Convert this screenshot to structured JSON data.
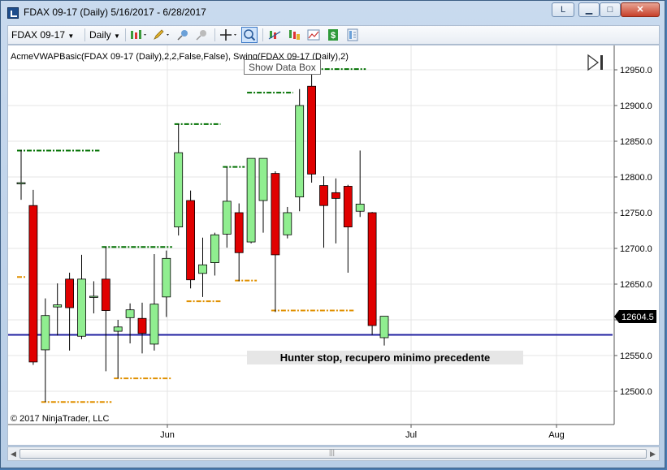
{
  "window": {
    "title": "FDAX 09-17 (Daily)  5/16/2017 - 6/28/2017",
    "layout_button": "L",
    "minimize_glyph": "▁",
    "maximize_glyph": "□",
    "close_glyph": "✕"
  },
  "toolbar": {
    "instrument": "FDAX 09-17",
    "period": "Daily",
    "icons": [
      "bar-type-icon",
      "pencil-draw-icon",
      "pin-icon",
      "unpin-icon",
      "crosshair-icon",
      "zoom-icon",
      "indicators-icon",
      "strategies-icon",
      "chart-style-icon",
      "dollar-icon",
      "properties-icon"
    ]
  },
  "tooltip": {
    "text": "Show Data Box"
  },
  "chart": {
    "indicator_label": "AcmeVWAPBasic(FDAX 09-17 (Daily),2,2,False,False), Swing(FDAX 09-17 (Daily),2)",
    "copyright": "© 2017 NinjaTrader, LLC",
    "annotation": "Hunter stop, recupero minimo precedente",
    "last_price_label": "12604.5",
    "colors": {
      "up": "#90ee90",
      "down": "#e00000",
      "swing_high": "#007000",
      "swing_low": "#e09000",
      "hline": "#1f1fa0"
    }
  },
  "chart_data": {
    "type": "candlestick",
    "instrument": "FDAX 09-17",
    "period": "Daily",
    "ylim": [
      12465,
      12975
    ],
    "y_ticks": [
      12500,
      12550,
      12600,
      12650,
      12700,
      12750,
      12800,
      12850,
      12900,
      12950
    ],
    "x_tick_labels": [
      "Jun",
      "Jul",
      "Aug"
    ],
    "candles": [
      {
        "o": 12792,
        "h": 12838,
        "l": 12768,
        "c": 12792
      },
      {
        "o": 12760,
        "h": 12782,
        "l": 12537,
        "c": 12541
      },
      {
        "o": 12558,
        "h": 12630,
        "l": 12485,
        "c": 12606
      },
      {
        "o": 12618,
        "h": 12651,
        "l": 12578,
        "c": 12621
      },
      {
        "o": 12657,
        "h": 12666,
        "l": 12557,
        "c": 12617
      },
      {
        "o": 12577,
        "h": 12691,
        "l": 12573,
        "c": 12657
      },
      {
        "o": 12633,
        "h": 12654,
        "l": 12609,
        "c": 12633
      },
      {
        "o": 12657,
        "h": 12702,
        "l": 12528,
        "c": 12613
      },
      {
        "o": 12584,
        "h": 12600,
        "l": 12518,
        "c": 12590
      },
      {
        "o": 12603,
        "h": 12623,
        "l": 12567,
        "c": 12614
      },
      {
        "o": 12602,
        "h": 12624,
        "l": 12553,
        "c": 12581
      },
      {
        "o": 12566,
        "h": 12692,
        "l": 12557,
        "c": 12622
      },
      {
        "o": 12632,
        "h": 12697,
        "l": 12604,
        "c": 12686
      },
      {
        "o": 12730,
        "h": 12874,
        "l": 12718,
        "c": 12834
      },
      {
        "o": 12767,
        "h": 12781,
        "l": 12644,
        "c": 12656
      },
      {
        "o": 12665,
        "h": 12715,
        "l": 12632,
        "c": 12677
      },
      {
        "o": 12680,
        "h": 12722,
        "l": 12662,
        "c": 12719
      },
      {
        "o": 12720,
        "h": 12814,
        "l": 12701,
        "c": 12766
      },
      {
        "o": 12750,
        "h": 12763,
        "l": 12654,
        "c": 12694
      },
      {
        "o": 12709,
        "h": 12794,
        "l": 12707,
        "c": 12826
      },
      {
        "o": 12767,
        "h": 12810,
        "l": 12722,
        "c": 12826
      },
      {
        "o": 12805,
        "h": 12808,
        "l": 12611,
        "c": 12691
      },
      {
        "o": 12719,
        "h": 12758,
        "l": 12714,
        "c": 12750
      },
      {
        "o": 12772,
        "h": 12923,
        "l": 12752,
        "c": 12900
      },
      {
        "o": 12927,
        "h": 12958,
        "l": 12792,
        "c": 12804
      },
      {
        "o": 12788,
        "h": 12801,
        "l": 12701,
        "c": 12760
      },
      {
        "o": 12778,
        "h": 12798,
        "l": 12707,
        "c": 12770
      },
      {
        "o": 12787,
        "h": 12789,
        "l": 12666,
        "c": 12730
      },
      {
        "o": 12752,
        "h": 12837,
        "l": 12744,
        "c": 12762
      },
      {
        "o": 12750,
        "h": 12751,
        "l": 12579,
        "c": 12592
      },
      {
        "o": 12575,
        "h": 12603,
        "l": 12564,
        "c": 12605
      }
    ],
    "swing_highs": [
      {
        "price": 12837,
        "from": 0,
        "to": 6
      },
      {
        "price": 12702,
        "from": 7,
        "to": 12
      },
      {
        "price": 12874,
        "from": 13,
        "to": 16
      },
      {
        "price": 12814,
        "from": 17,
        "to": 18
      },
      {
        "price": 12918,
        "from": 19,
        "to": 22
      },
      {
        "price": 12951,
        "from": 23,
        "to": 28
      }
    ],
    "swing_lows": [
      {
        "price": 12660,
        "from": 0,
        "to": 0
      },
      {
        "price": 12485,
        "from": 2,
        "to": 7
      },
      {
        "price": 12518,
        "from": 8,
        "to": 12
      },
      {
        "price": 12626,
        "from": 14,
        "to": 16
      },
      {
        "price": 12655,
        "from": 18,
        "to": 19
      },
      {
        "price": 12613,
        "from": 21,
        "to": 27
      }
    ],
    "horizontal_line": 12579,
    "last_price": 12604.5
  }
}
